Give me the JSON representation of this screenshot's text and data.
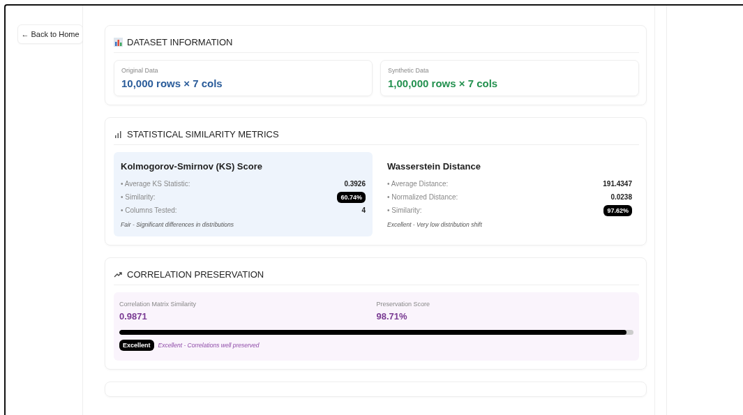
{
  "back_button": {
    "label": "← Back to Home"
  },
  "dataset_information": {
    "title": "DATASET INFORMATION",
    "items": [
      {
        "label": "Original Data",
        "value": "10,000 rows × 7 cols",
        "color": "#2a5c9a"
      },
      {
        "label": "Synthetic Data",
        "value": "1,00,000 rows × 7 cols",
        "color": "#23914f"
      }
    ]
  },
  "statistical_similarity": {
    "title": "STATISTICAL SIMILARITY METRICS",
    "metrics": [
      {
        "title": "Kolmogorov-Smirnov (KS) Score",
        "highlighted": true,
        "rows": [
          {
            "label": "• Average KS Statistic:",
            "value": "0.3926",
            "kind": "plain"
          },
          {
            "label": "• Similarity:",
            "value": "60.74%",
            "kind": "badge"
          },
          {
            "label": "• Columns Tested:",
            "value": "4",
            "kind": "plain"
          }
        ],
        "note": "Fair - Significant differences in distributions"
      },
      {
        "title": "Wasserstein Distance",
        "highlighted": false,
        "rows": [
          {
            "label": "• Average Distance:",
            "value": "191.4347",
            "kind": "plain"
          },
          {
            "label": "• Normalized Distance:",
            "value": "0.0238",
            "kind": "plain"
          },
          {
            "label": "• Similarity:",
            "value": "97.62%",
            "kind": "badge"
          }
        ],
        "note": "Excellent - Very low distribution shift"
      }
    ]
  },
  "correlation_preservation": {
    "title": "CORRELATION PRESERVATION",
    "stats": [
      {
        "label": "Correlation Matrix Similarity",
        "value": "0.9871"
      },
      {
        "label": "Preservation Score",
        "value": "98.71%"
      }
    ],
    "progress": {
      "level": 0.9871
    },
    "badge": "Excellent",
    "note": "Excellent - Correlations well preserved"
  }
}
